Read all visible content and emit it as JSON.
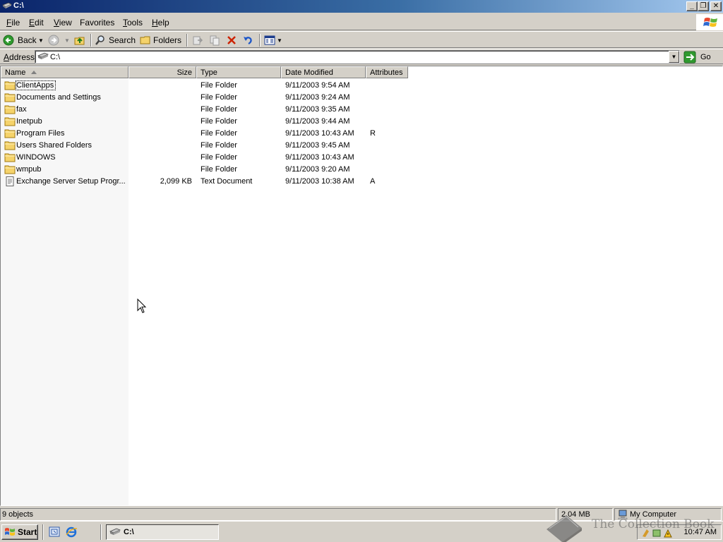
{
  "window": {
    "title": "C:\\",
    "buttons": {
      "minimize": "_",
      "restore": "❐",
      "close": "✕"
    }
  },
  "menu": [
    {
      "mnemonic": "F",
      "rest": "ile"
    },
    {
      "mnemonic": "E",
      "rest": "dit"
    },
    {
      "mnemonic": "V",
      "rest": "iew"
    },
    {
      "mnemonic": "",
      "rest": "Favorites",
      "pre": "F",
      "ul_index": 0
    },
    {
      "mnemonic": "T",
      "rest": "ools"
    },
    {
      "mnemonic": "H",
      "rest": "elp"
    }
  ],
  "toolbar": {
    "back_label": "Back",
    "search_label": "Search",
    "folders_label": "Folders"
  },
  "address": {
    "label_pre": "A",
    "label_rest": "ddress",
    "value": "C:\\",
    "go_label": "Go"
  },
  "list": {
    "columns": {
      "name": "Name",
      "size": "Size",
      "type": "Type",
      "date": "Date Modified",
      "attributes": "Attributes"
    },
    "rows": [
      {
        "name": "ClientApps",
        "size": "",
        "type": "File Folder",
        "date": "9/11/2003 9:54 AM",
        "attributes": "",
        "kind": "folder-icon"
      },
      {
        "name": "Documents and Settings",
        "size": "",
        "type": "File Folder",
        "date": "9/11/2003 9:24 AM",
        "attributes": "",
        "kind": "folder-icon"
      },
      {
        "name": "fax",
        "size": "",
        "type": "File Folder",
        "date": "9/11/2003 9:35 AM",
        "attributes": "",
        "kind": "folder-icon"
      },
      {
        "name": "Inetpub",
        "size": "",
        "type": "File Folder",
        "date": "9/11/2003 9:44 AM",
        "attributes": "",
        "kind": "folder-icon"
      },
      {
        "name": "Program Files",
        "size": "",
        "type": "File Folder",
        "date": "9/11/2003 10:43 AM",
        "attributes": "R",
        "kind": "folder-icon"
      },
      {
        "name": "Users Shared Folders",
        "size": "",
        "type": "File Folder",
        "date": "9/11/2003 9:45 AM",
        "attributes": "",
        "kind": "folder-icon"
      },
      {
        "name": "WINDOWS",
        "size": "",
        "type": "File Folder",
        "date": "9/11/2003 10:43 AM",
        "attributes": "",
        "kind": "folder-icon"
      },
      {
        "name": "wmpub",
        "size": "",
        "type": "File Folder",
        "date": "9/11/2003 9:20 AM",
        "attributes": "",
        "kind": "folder-icon"
      },
      {
        "name": "Exchange Server Setup Progr...",
        "size": "2,099 KB",
        "type": "Text Document",
        "date": "9/11/2003 10:38 AM",
        "attributes": "A",
        "kind": "text-document-icon"
      }
    ]
  },
  "status": {
    "objects": "9 objects",
    "size": "2.04 MB",
    "location": "My Computer"
  },
  "taskbar": {
    "start_label": "Start",
    "task_label": "C:\\",
    "clock": "10:47 AM"
  },
  "watermark": "The Collection Book",
  "colors": {
    "title_gradient_start": "#0a246a",
    "title_gradient_end": "#a6caf0",
    "chrome": "#d4d0c8",
    "folder": "#f5d36b",
    "delete_red": "#cc2200",
    "go_green": "#2f9a2f"
  }
}
